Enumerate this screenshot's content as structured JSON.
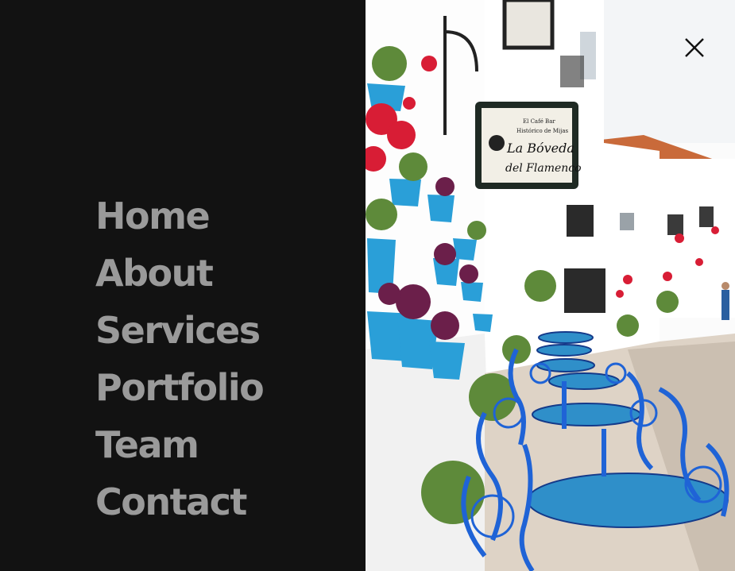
{
  "menu": {
    "items": [
      {
        "label": "Home"
      },
      {
        "label": "About"
      },
      {
        "label": "Services"
      },
      {
        "label": "Portfolio"
      },
      {
        "label": "Team"
      },
      {
        "label": "Contact"
      }
    ]
  },
  "hero_image": {
    "sign_line1": "El Café Bar",
    "sign_line2": "Histórico de Mijas",
    "sign_line3": "La Bóveda",
    "sign_line4": "del Flamenco"
  },
  "close": {
    "icon": "close-icon"
  },
  "colors": {
    "panel_bg": "#121212",
    "menu_text": "#9a9a9a",
    "pot_blue": "#2a9fd8",
    "furniture_blue": "#1f63d6",
    "flower_red": "#d81d35",
    "leaf_purple": "#6b1f4a"
  }
}
